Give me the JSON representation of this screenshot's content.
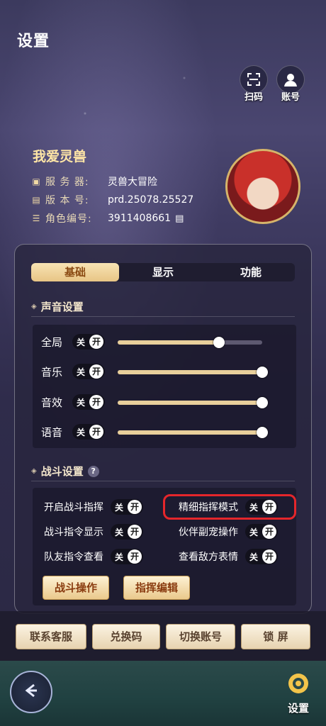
{
  "header": {
    "title": "设置"
  },
  "top_actions": [
    {
      "label": "扫码",
      "icon": "scan-icon"
    },
    {
      "label": "账号",
      "icon": "account-icon"
    }
  ],
  "profile": {
    "name": "我爱灵兽",
    "server_label": "服 务 器:",
    "server_value": "灵兽大冒险",
    "version_label": "版 本 号:",
    "version_value": "prd.25078.25527",
    "role_label": "角色编号:",
    "role_value": "3911408661"
  },
  "tabs": [
    "基础",
    "显示",
    "功能"
  ],
  "sound": {
    "title": "声音设置",
    "rows": [
      {
        "label": "全局",
        "off": "关",
        "on": "开",
        "level": 0.7
      },
      {
        "label": "音乐",
        "off": "关",
        "on": "开",
        "level": 1.0
      },
      {
        "label": "音效",
        "off": "关",
        "on": "开",
        "level": 1.0
      },
      {
        "label": "语音",
        "off": "关",
        "on": "开",
        "level": 1.0
      }
    ]
  },
  "battle": {
    "title": "战斗设置",
    "help": "?",
    "items": [
      {
        "label": "开启战斗指挥",
        "off": "关",
        "on": "开"
      },
      {
        "label": "精细指挥模式",
        "off": "关",
        "on": "开"
      },
      {
        "label": "战斗指令显示",
        "off": "关",
        "on": "开"
      },
      {
        "label": "伙伴副宠操作",
        "off": "关",
        "on": "开"
      },
      {
        "label": "队友指令查看",
        "off": "关",
        "on": "开"
      },
      {
        "label": "查看敌方表情",
        "off": "关",
        "on": "开"
      }
    ],
    "buttons": [
      "战斗操作",
      "指挥编辑"
    ]
  },
  "bottom_buttons": [
    "联系客服",
    "兑换码",
    "切换账号",
    "锁 屏"
  ],
  "footer": {
    "settings_label": "设置"
  },
  "colors": {
    "accent": "#e8c585",
    "highlight": "#e5262b"
  }
}
